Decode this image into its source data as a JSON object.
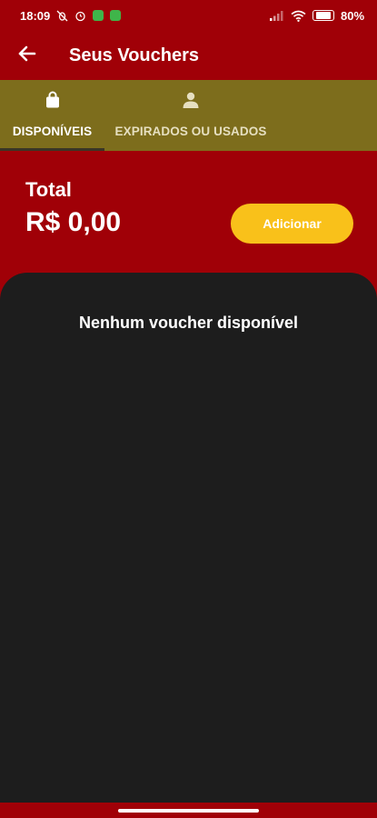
{
  "status_bar": {
    "time": "18:09",
    "battery": "80",
    "left_icons": [
      "bug-icon",
      "alarm-icon",
      "green-app-icon",
      "green-app-icon"
    ],
    "right_icons": [
      "signal-icon",
      "wifi-icon",
      "battery-icon"
    ]
  },
  "app_bar": {
    "title": "Seus Vouchers",
    "back_icon": "arrow-left-icon"
  },
  "tabs": [
    {
      "label": "DISPONÍVEIS",
      "icon": "shopping-bag-icon",
      "active": true
    },
    {
      "label": "EXPIRADOS OU USADOS",
      "icon": "person-icon",
      "active": false
    }
  ],
  "summary": {
    "total_label": "Total",
    "total_value": "R$ 0,00",
    "add_label": "Adicionar"
  },
  "content": {
    "empty_message": "Nenhum voucher disponível"
  },
  "colors": {
    "primary_red": "#a00007",
    "tab_bar_olive": "#7d6d1c",
    "button_yellow": "#f9c11a",
    "panel_dark": "#1d1d1d"
  }
}
